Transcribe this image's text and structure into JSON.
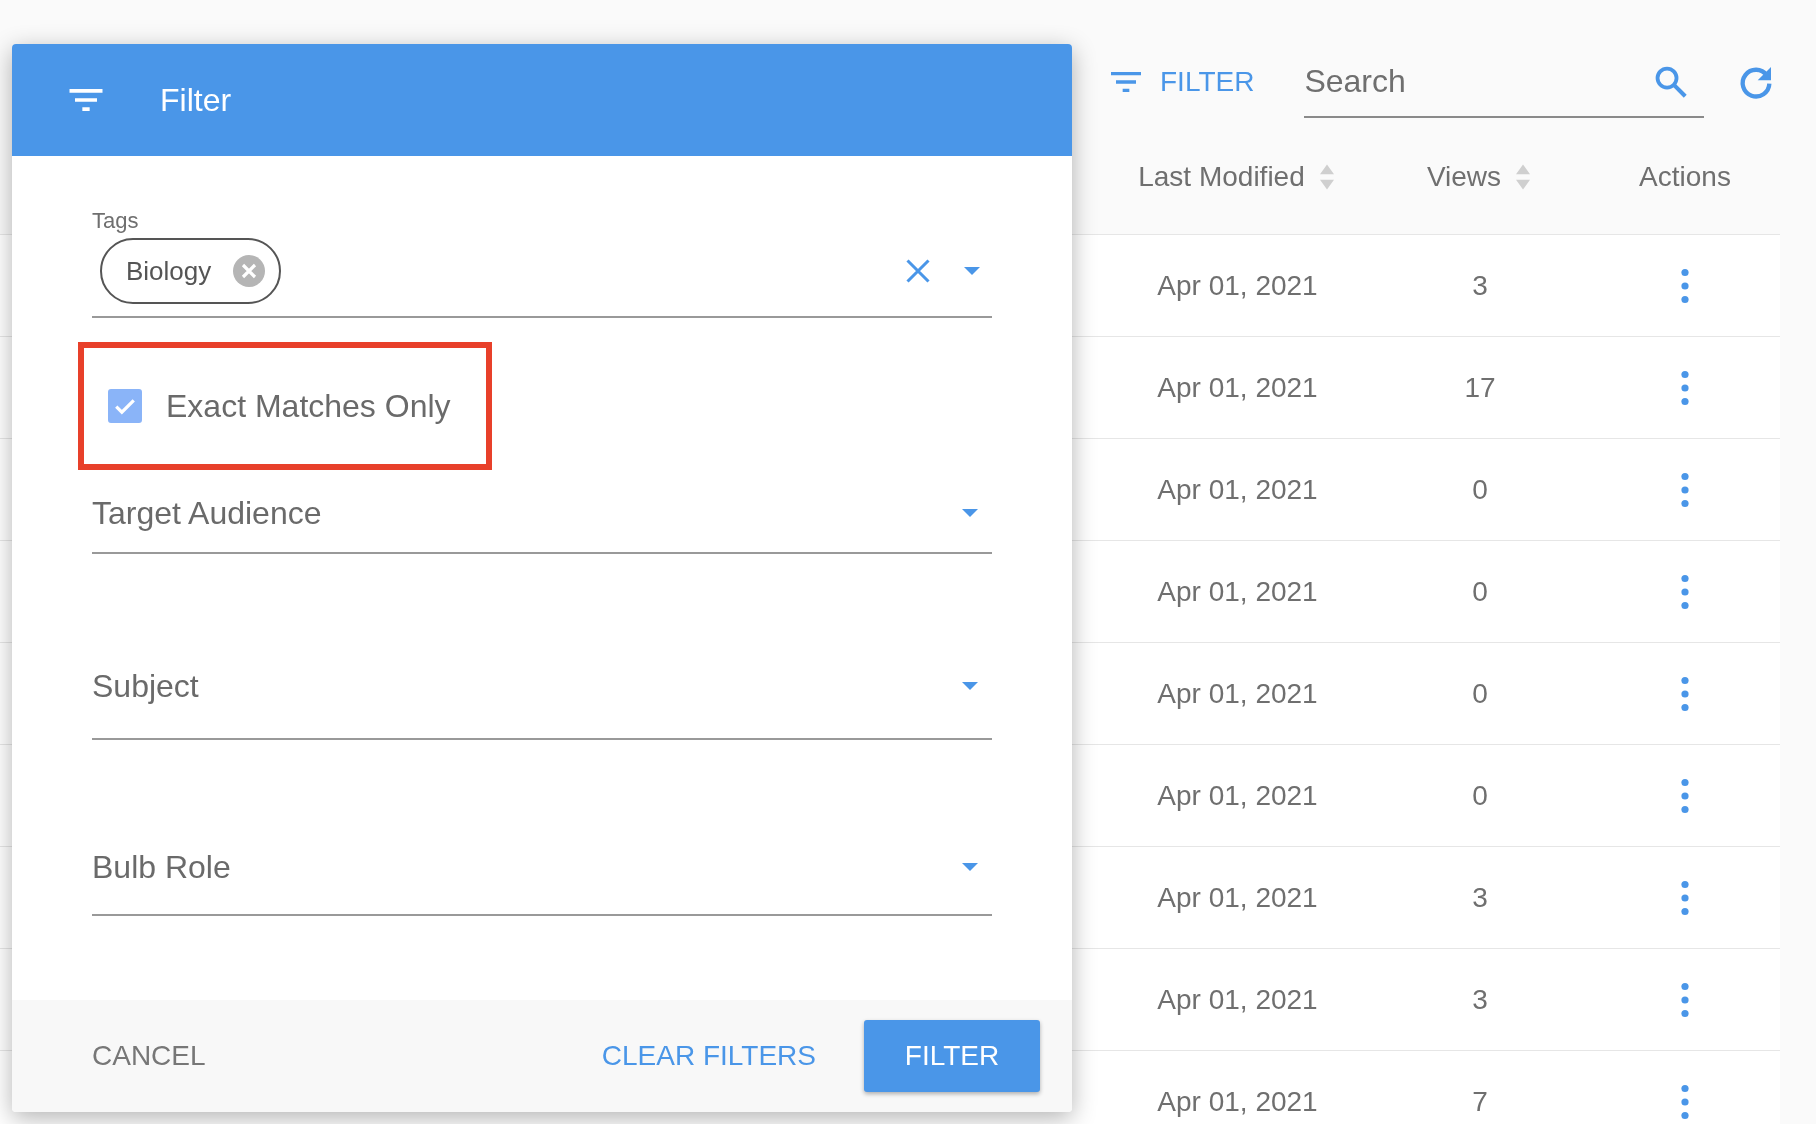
{
  "toolbar": {
    "filter_button": "FILTER",
    "search": {
      "placeholder": "Search"
    }
  },
  "table": {
    "columns": [
      {
        "label": "Last Modified",
        "sortable": true
      },
      {
        "label": "Views",
        "sortable": true
      },
      {
        "label": "Actions",
        "sortable": false
      }
    ],
    "rows": [
      {
        "last_modified": "Apr 01, 2021",
        "views": "3"
      },
      {
        "last_modified": "Apr 01, 2021",
        "views": "17"
      },
      {
        "last_modified": "Apr 01, 2021",
        "views": "0"
      },
      {
        "last_modified": "Apr 01, 2021",
        "views": "0"
      },
      {
        "last_modified": "Apr 01, 2021",
        "views": "0"
      },
      {
        "last_modified": "Apr 01, 2021",
        "views": "0"
      },
      {
        "last_modified": "Apr 01, 2021",
        "views": "3"
      },
      {
        "last_modified": "Apr 01, 2021",
        "views": "3"
      },
      {
        "last_modified": "Apr 01, 2021",
        "views": "7"
      }
    ]
  },
  "dialog": {
    "title": "Filter",
    "tags": {
      "label": "Tags",
      "chips": [
        "Biology"
      ]
    },
    "exact_match": {
      "label": "Exact Matches Only",
      "checked": true,
      "highlighted": true
    },
    "selects": [
      {
        "label": "Target Audience"
      },
      {
        "label": "Subject"
      },
      {
        "label": "Bulb Role"
      }
    ],
    "buttons": [
      {
        "label": "CANCEL",
        "kind": "text"
      },
      {
        "label": "CLEAR FILTERS",
        "kind": "link"
      },
      {
        "label": "FILTER",
        "kind": "primary"
      }
    ]
  }
}
